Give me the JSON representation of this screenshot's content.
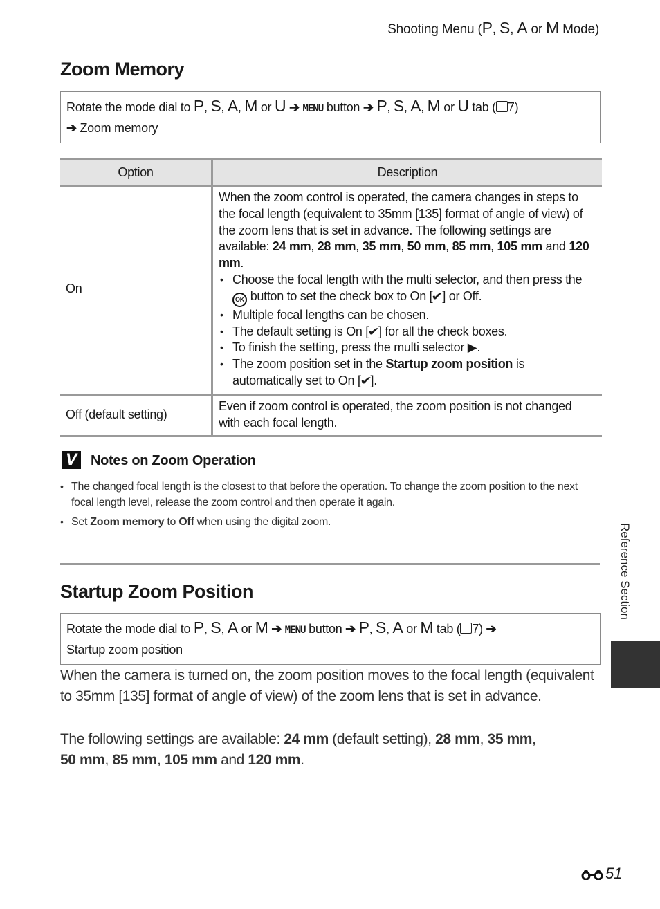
{
  "running_head": {
    "prefix": "Shooting Menu (",
    "modes": [
      "P",
      "S",
      "A",
      "M"
    ],
    "sep1": ", ",
    "sep2": ", ",
    "or": " or ",
    "suffix": " Mode)"
  },
  "zoom_memory": {
    "title": "Zoom Memory",
    "nav": {
      "text1": "Rotate the mode dial to ",
      "modes": [
        "P",
        "S",
        "A",
        "M",
        "U"
      ],
      "or": " or ",
      "arrow": " ➔ ",
      "menu_label": "MENU",
      "button_text": " button",
      "tab_text": " tab (",
      "page_ref": "7)",
      "item": "Zoom memory"
    },
    "table": {
      "headers": [
        "Option",
        "Description"
      ],
      "rows": [
        {
          "option": "On",
          "intro_1": "When the zoom control is operated, the camera changes in steps to the focal length (equivalent to 35mm [135] format of angle of view) of the zoom lens that is set in advance. The following settings are available: ",
          "settings": [
            "24 mm",
            "28 mm",
            "35 mm",
            "50 mm",
            "85 mm",
            "105 mm",
            "120 mm"
          ],
          "and": " and ",
          "bullets": {
            "b1_a": "Choose the focal length with the multi selector, and then press the ",
            "b1_ok": "OK",
            "b1_b": " button to set the check box to On [",
            "b1_c": "] or Off.",
            "b2": "Multiple focal lengths can be chosen.",
            "b3_a": "The default setting is On [",
            "b3_b": "] for all the check boxes.",
            "b4": "To finish the setting, press the multi selector ",
            "b4_arrow": "▶",
            "b5_a": "The zoom position set in the ",
            "b5_bold": "Startup zoom position",
            "b5_b": " is automatically set to On [",
            "b5_c": "]."
          },
          "check_glyph": "✔"
        },
        {
          "option": "Off (default setting)",
          "description": "Even if zoom control is operated, the zoom position is not changed with each focal length."
        }
      ]
    },
    "notes": {
      "icon": "V",
      "title": "Notes on Zoom Operation",
      "items": [
        {
          "text": "The changed focal length is the closest to that before the operation. To change the zoom position to the next focal length level, release the zoom control and then operate it again."
        },
        {
          "a": "Set ",
          "b1": "Zoom memory",
          "c": " to ",
          "b2": "Off",
          "d": " when using the digital zoom."
        }
      ]
    }
  },
  "startup_zoom": {
    "title": "Startup Zoom Position",
    "nav": {
      "text1": "Rotate the mode dial to ",
      "modes": [
        "P",
        "S",
        "A",
        "M"
      ],
      "or": " or ",
      "arrow": " ➔ ",
      "menu_label": "MENU",
      "button_text": " button",
      "tab_text": " tab (",
      "page_ref": "7)",
      "item": "Startup zoom position"
    },
    "para1": "When the camera is turned on, the zoom position moves to the focal length (equivalent to 35mm [135] format of angle of view) of the zoom lens that is set in advance.",
    "para2_a": "The following settings are available: ",
    "default_setting": "24 mm",
    "default_note": " (default setting), ",
    "settings": [
      "28 mm",
      "35 mm",
      "50 mm",
      "85 mm",
      "105 mm",
      "120 mm"
    ],
    "and": " and "
  },
  "side_label": "Reference Section",
  "page_number": "51"
}
